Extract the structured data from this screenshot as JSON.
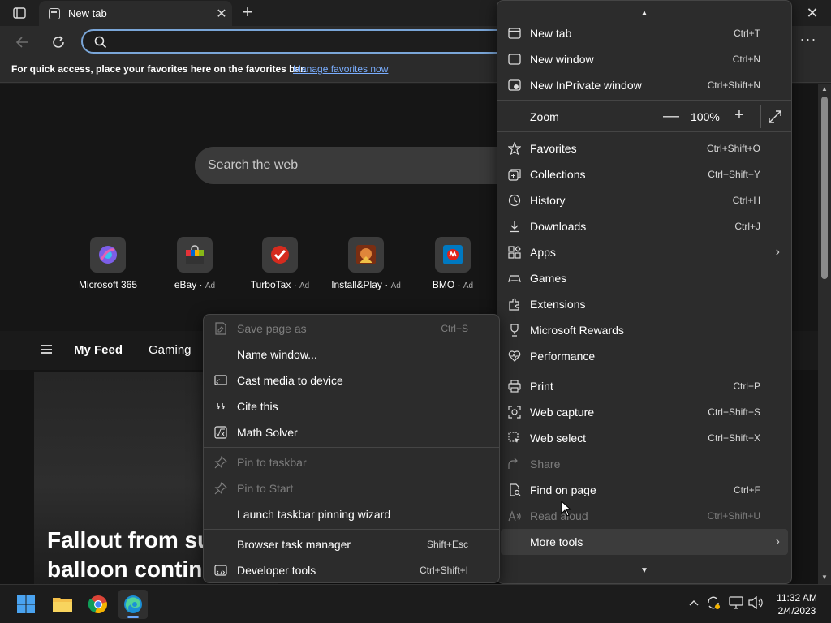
{
  "tab": {
    "title": "New tab"
  },
  "favorites_bar": {
    "message": "For quick access, place your favorites here on the favorites bar.",
    "link": "Manage favorites now"
  },
  "page": {
    "search_placeholder": "Search the web",
    "quick_links": [
      {
        "name": "Microsoft 365",
        "ad": "",
        "color": "#6b5bd6"
      },
      {
        "name": "eBay",
        "ad": "Ad",
        "color": "#e53238"
      },
      {
        "name": "TurboTax",
        "ad": "Ad",
        "color": "#d52b1e"
      },
      {
        "name": "Install&Play",
        "ad": "Ad",
        "color": "#b5451b"
      },
      {
        "name": "BMO",
        "ad": "Ad",
        "color": "#0079c1"
      }
    ],
    "feed": {
      "my_feed": "My Feed",
      "gaming": "Gaming"
    },
    "headline_line1": "Fallout from su",
    "headline_line2": "balloon continu"
  },
  "menu": {
    "new_tab": {
      "label": "New tab",
      "shortcut": "Ctrl+T"
    },
    "new_window": {
      "label": "New window",
      "shortcut": "Ctrl+N"
    },
    "new_inprivate": {
      "label": "New InPrivate window",
      "shortcut": "Ctrl+Shift+N"
    },
    "zoom": {
      "label": "Zoom",
      "value": "100%",
      "minus": "—",
      "plus": "+"
    },
    "favorites": {
      "label": "Favorites",
      "shortcut": "Ctrl+Shift+O"
    },
    "collections": {
      "label": "Collections",
      "shortcut": "Ctrl+Shift+Y"
    },
    "history": {
      "label": "History",
      "shortcut": "Ctrl+H"
    },
    "downloads": {
      "label": "Downloads",
      "shortcut": "Ctrl+J"
    },
    "apps": {
      "label": "Apps"
    },
    "games": {
      "label": "Games"
    },
    "extensions": {
      "label": "Extensions"
    },
    "rewards": {
      "label": "Microsoft Rewards"
    },
    "performance": {
      "label": "Performance"
    },
    "print": {
      "label": "Print",
      "shortcut": "Ctrl+P"
    },
    "web_capture": {
      "label": "Web capture",
      "shortcut": "Ctrl+Shift+S"
    },
    "web_select": {
      "label": "Web select",
      "shortcut": "Ctrl+Shift+X"
    },
    "share": {
      "label": "Share"
    },
    "find": {
      "label": "Find on page",
      "shortcut": "Ctrl+F"
    },
    "read_aloud": {
      "label": "Read aloud",
      "shortcut": "Ctrl+Shift+U"
    },
    "more_tools": {
      "label": "More tools"
    }
  },
  "submenu": {
    "save_page": {
      "label": "Save page as",
      "shortcut": "Ctrl+S"
    },
    "name_window": {
      "label": "Name window..."
    },
    "cast": {
      "label": "Cast media to device"
    },
    "cite": {
      "label": "Cite this"
    },
    "math": {
      "label": "Math Solver"
    },
    "pin_taskbar": {
      "label": "Pin to taskbar"
    },
    "pin_start": {
      "label": "Pin to Start"
    },
    "pin_wizard": {
      "label": "Launch taskbar pinning wizard"
    },
    "task_manager": {
      "label": "Browser task manager",
      "shortcut": "Shift+Esc"
    },
    "dev_tools": {
      "label": "Developer tools",
      "shortcut": "Ctrl+Shift+I"
    }
  },
  "taskbar": {
    "time": "11:32 AM",
    "date": "2/4/2023"
  },
  "colors": {
    "accent": "#7aa6d8",
    "link": "#7aaeff",
    "menu_bg": "#2c2c2c",
    "disabled": "#7d7d7d"
  }
}
